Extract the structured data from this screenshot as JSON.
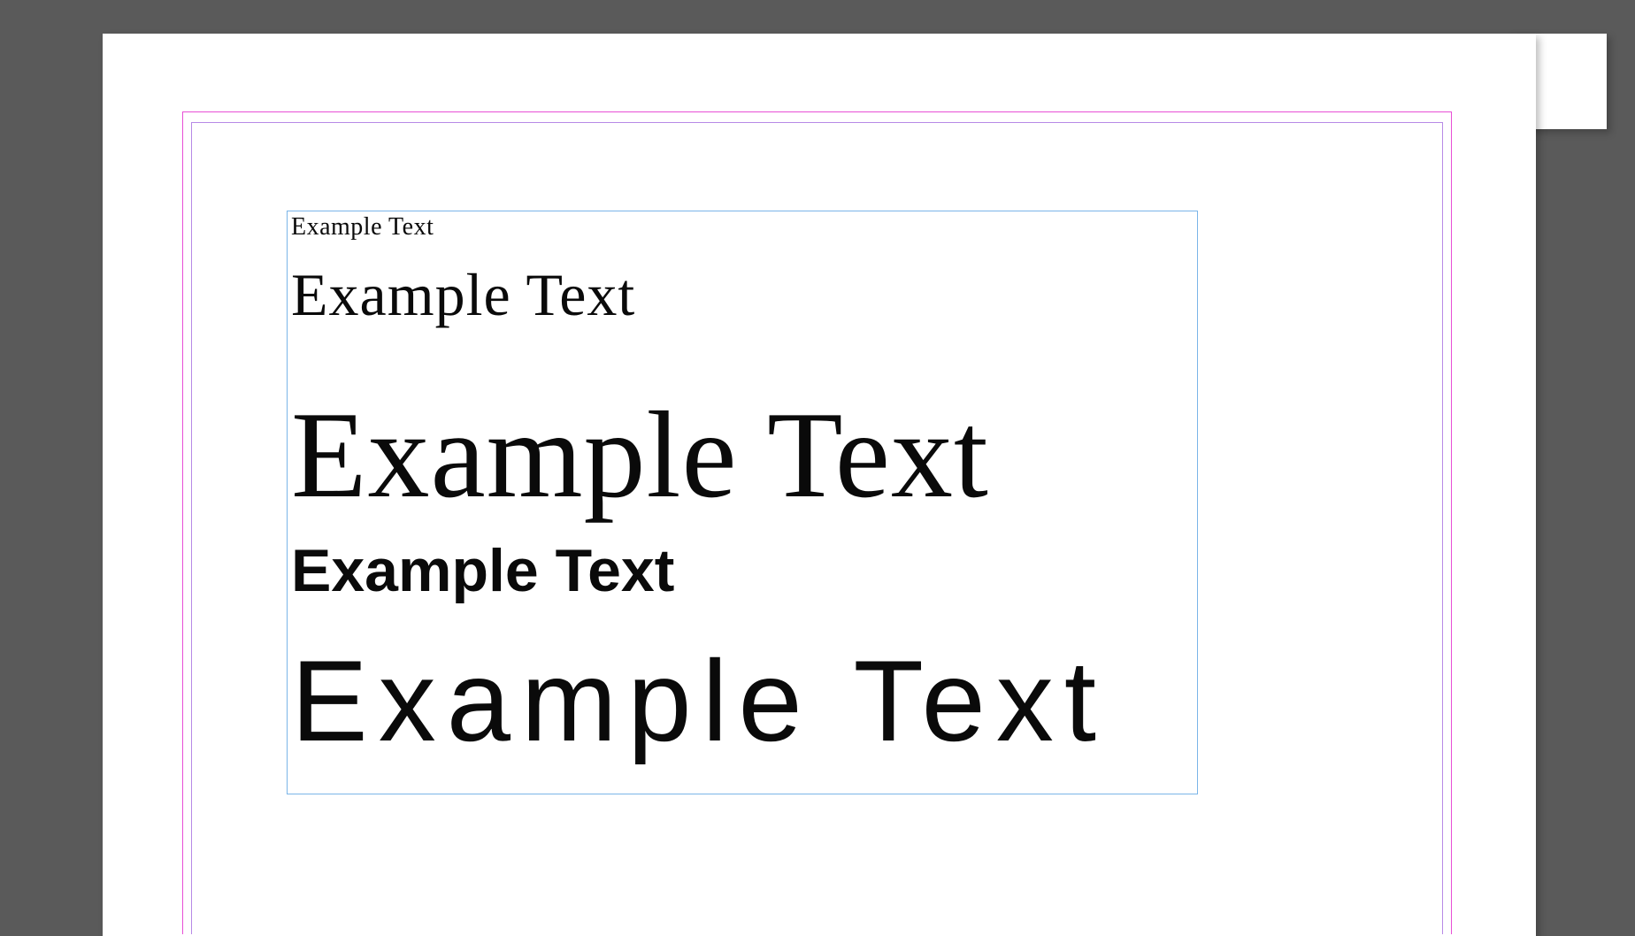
{
  "canvas": {
    "background": "#5a5a5a",
    "page_color": "#ffffff",
    "margin_outer_color": "#e84fd6",
    "margin_inner_color": "#b78ae6",
    "frame_border_color": "#7bb5e8"
  },
  "text_frame": {
    "lines": [
      {
        "text": "Example Text",
        "style": "serif-small"
      },
      {
        "text": "Example Text",
        "style": "serif-medium"
      },
      {
        "text": "Example Text",
        "style": "serif-large"
      },
      {
        "text": "Example Text",
        "style": "sans-semibold-medium"
      },
      {
        "text": "Example Text",
        "style": "sans-thin-large"
      }
    ]
  }
}
